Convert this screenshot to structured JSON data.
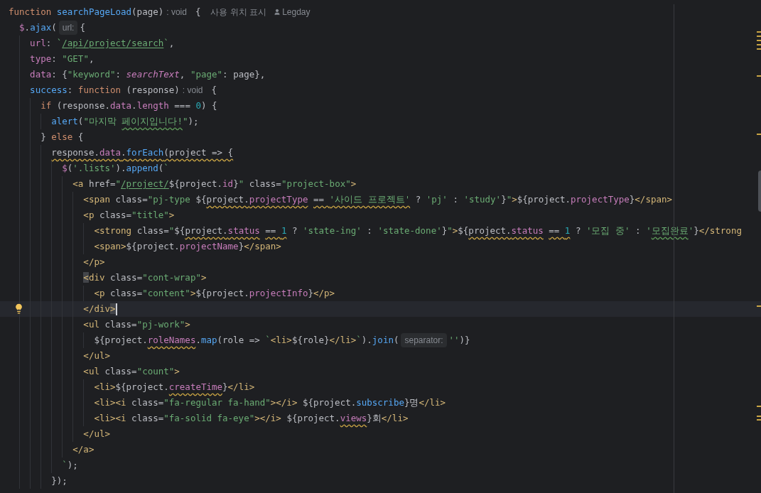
{
  "editor": {
    "lines": [
      {
        "current": false,
        "bulb": false,
        "tokens": [
          {
            "kind": "keyword",
            "text": "function "
          },
          {
            "kind": "fn",
            "text": "searchPageLoad"
          },
          {
            "kind": "plain",
            "text": "(page)"
          },
          {
            "kind": "typehint",
            "text": ": void"
          },
          {
            "kind": "plain",
            "text": "{"
          },
          {
            "kind": "meta",
            "text": "사용 위치 표시"
          },
          {
            "kind": "author",
            "text": "Legday"
          }
        ]
      },
      {
        "current": false,
        "bulb": false,
        "tokens": [
          {
            "kind": "prop",
            "text": "  $"
          },
          {
            "kind": "plain",
            "text": "."
          },
          {
            "kind": "fn",
            "text": "ajax"
          },
          {
            "kind": "plain",
            "text": "("
          },
          {
            "kind": "hint",
            "text": "url:"
          },
          {
            "kind": "plain",
            "text": "{"
          }
        ]
      },
      {
        "current": false,
        "bulb": false,
        "tokens": [
          {
            "kind": "prop",
            "text": "    url"
          },
          {
            "kind": "plain",
            "text": ": "
          },
          {
            "kind": "str",
            "text": "`"
          },
          {
            "kind": "link",
            "text": "/api/project/search"
          },
          {
            "kind": "str",
            "text": "`"
          },
          {
            "kind": "plain",
            "text": ","
          }
        ]
      },
      {
        "current": false,
        "bulb": false,
        "tokens": [
          {
            "kind": "prop",
            "text": "    type"
          },
          {
            "kind": "plain",
            "text": ": "
          },
          {
            "kind": "str",
            "text": "\"GET\""
          },
          {
            "kind": "plain",
            "text": ","
          }
        ]
      },
      {
        "current": false,
        "bulb": false,
        "tokens": [
          {
            "kind": "prop",
            "text": "    data"
          },
          {
            "kind": "plain",
            "text": ": {"
          },
          {
            "kind": "str",
            "text": "\"keyword\""
          },
          {
            "kind": "plain",
            "text": ": "
          },
          {
            "kind": "global",
            "text": "searchText"
          },
          {
            "kind": "plain",
            "text": ", "
          },
          {
            "kind": "str",
            "text": "\"page\""
          },
          {
            "kind": "plain",
            "text": ": page},"
          }
        ]
      },
      {
        "current": false,
        "bulb": false,
        "tokens": [
          {
            "kind": "fn",
            "text": "    success"
          },
          {
            "kind": "plain",
            "text": ": "
          },
          {
            "kind": "keyword",
            "text": "function "
          },
          {
            "kind": "plain",
            "text": "(response)"
          },
          {
            "kind": "typehint",
            "text": ": void"
          },
          {
            "kind": "plain",
            "text": "{"
          }
        ]
      },
      {
        "current": false,
        "bulb": false,
        "tokens": [
          {
            "kind": "keyword",
            "text": "      if "
          },
          {
            "kind": "plain",
            "text": "(response."
          },
          {
            "kind": "prop",
            "text": "data"
          },
          {
            "kind": "plain",
            "text": "."
          },
          {
            "kind": "prop",
            "text": "length"
          },
          {
            "kind": "plain",
            "text": " === "
          },
          {
            "kind": "num",
            "text": "0"
          },
          {
            "kind": "plain",
            "text": ") {"
          }
        ]
      },
      {
        "current": false,
        "bulb": false,
        "tokens": [
          {
            "kind": "fn",
            "text": "        alert"
          },
          {
            "kind": "plain",
            "text": "("
          },
          {
            "kind": "str",
            "text": "\"마지막 "
          },
          {
            "kind": "str",
            "text": "페이지입니다!",
            "typo": true
          },
          {
            "kind": "str",
            "text": "\""
          },
          {
            "kind": "plain",
            "text": ");"
          }
        ]
      },
      {
        "current": false,
        "bulb": false,
        "tokens": [
          {
            "kind": "plain",
            "text": "      } "
          },
          {
            "kind": "keyword",
            "text": "else "
          },
          {
            "kind": "plain",
            "text": "{"
          }
        ]
      },
      {
        "current": false,
        "bulb": false,
        "tokens": [
          {
            "kind": "plain",
            "text": "        response.",
            "warning": true
          },
          {
            "kind": "prop",
            "text": "data",
            "warning": true
          },
          {
            "kind": "plain",
            "text": ".",
            "warning": true
          },
          {
            "kind": "fn",
            "text": "forEach",
            "warning": true
          },
          {
            "kind": "plain",
            "text": "(project => {",
            "warning": true
          }
        ]
      },
      {
        "current": false,
        "bulb": false,
        "tokens": [
          {
            "kind": "prop",
            "text": "          $"
          },
          {
            "kind": "plain",
            "text": "("
          },
          {
            "kind": "str",
            "text": "'.lists'"
          },
          {
            "kind": "plain",
            "text": ")."
          },
          {
            "kind": "fn",
            "text": "append"
          },
          {
            "kind": "plain",
            "text": "("
          },
          {
            "kind": "str",
            "text": "`"
          }
        ]
      },
      {
        "current": false,
        "bulb": false,
        "tokens": [
          {
            "kind": "tag",
            "text": "            <a "
          },
          {
            "kind": "plain",
            "text": "href="
          },
          {
            "kind": "str",
            "text": "\""
          },
          {
            "kind": "link",
            "text": "/project/"
          },
          {
            "kind": "plain",
            "text": "${project."
          },
          {
            "kind": "prop",
            "text": "id"
          },
          {
            "kind": "plain",
            "text": "}"
          },
          {
            "kind": "str",
            "text": "\""
          },
          {
            "kind": "plain",
            "text": " class="
          },
          {
            "kind": "str",
            "text": "\"project-box\""
          },
          {
            "kind": "tag",
            "text": ">"
          }
        ]
      },
      {
        "current": false,
        "bulb": false,
        "tokens": [
          {
            "kind": "tag",
            "text": "              <span "
          },
          {
            "kind": "plain",
            "text": "class="
          },
          {
            "kind": "str",
            "text": "\"pj-type "
          },
          {
            "kind": "plain",
            "text": "${"
          },
          {
            "kind": "plain",
            "text": "project.",
            "warning": true
          },
          {
            "kind": "prop",
            "text": "projectType",
            "warning": true
          },
          {
            "kind": "plain",
            "text": " == ",
            "warning": true
          },
          {
            "kind": "str",
            "text": "'사이드 프로젝트'",
            "warning": true
          },
          {
            "kind": "plain",
            "text": " ? "
          },
          {
            "kind": "str",
            "text": "'pj'"
          },
          {
            "kind": "plain",
            "text": " : "
          },
          {
            "kind": "str",
            "text": "'study'"
          },
          {
            "kind": "plain",
            "text": "}"
          },
          {
            "kind": "str",
            "text": "\""
          },
          {
            "kind": "tag",
            "text": ">"
          },
          {
            "kind": "plain",
            "text": "${project."
          },
          {
            "kind": "prop",
            "text": "projectType"
          },
          {
            "kind": "plain",
            "text": "}"
          },
          {
            "kind": "tag",
            "text": "</span>"
          }
        ]
      },
      {
        "current": false,
        "bulb": false,
        "tokens": [
          {
            "kind": "tag",
            "text": "              <p "
          },
          {
            "kind": "plain",
            "text": "class="
          },
          {
            "kind": "str",
            "text": "\"title\""
          },
          {
            "kind": "tag",
            "text": ">"
          }
        ]
      },
      {
        "current": false,
        "bulb": false,
        "tokens": [
          {
            "kind": "tag",
            "text": "                <strong "
          },
          {
            "kind": "plain",
            "text": "class="
          },
          {
            "kind": "str",
            "text": "\""
          },
          {
            "kind": "plain",
            "text": "${"
          },
          {
            "kind": "plain",
            "text": "project.",
            "warning": true
          },
          {
            "kind": "prop",
            "text": "status",
            "warning": true
          },
          {
            "kind": "plain",
            "text": " == ",
            "warning": true
          },
          {
            "kind": "num",
            "text": "1",
            "warning": true
          },
          {
            "kind": "plain",
            "text": " ? "
          },
          {
            "kind": "str",
            "text": "'state-ing'"
          },
          {
            "kind": "plain",
            "text": " : "
          },
          {
            "kind": "str",
            "text": "'state-done'"
          },
          {
            "kind": "plain",
            "text": "}"
          },
          {
            "kind": "str",
            "text": "\""
          },
          {
            "kind": "tag",
            "text": ">"
          },
          {
            "kind": "plain",
            "text": "${"
          },
          {
            "kind": "plain",
            "text": "project.",
            "warning": true
          },
          {
            "kind": "prop",
            "text": "status",
            "warning": true
          },
          {
            "kind": "plain",
            "text": " == ",
            "warning": true
          },
          {
            "kind": "num",
            "text": "1",
            "warning": true
          },
          {
            "kind": "plain",
            "text": " ? "
          },
          {
            "kind": "str",
            "text": "'모집 중'"
          },
          {
            "kind": "plain",
            "text": " : "
          },
          {
            "kind": "str",
            "text": "'"
          },
          {
            "kind": "str",
            "text": "모집완료",
            "typo": true
          },
          {
            "kind": "str",
            "text": "'"
          },
          {
            "kind": "plain",
            "text": "}"
          },
          {
            "kind": "tag",
            "text": "</strong"
          }
        ]
      },
      {
        "current": false,
        "bulb": false,
        "tokens": [
          {
            "kind": "tag",
            "text": "                <span>"
          },
          {
            "kind": "plain",
            "text": "${project."
          },
          {
            "kind": "prop",
            "text": "projectName"
          },
          {
            "kind": "plain",
            "text": "}"
          },
          {
            "kind": "tag",
            "text": "</span>"
          }
        ]
      },
      {
        "current": false,
        "bulb": false,
        "tokens": [
          {
            "kind": "tag",
            "text": "              </p>"
          }
        ]
      },
      {
        "current": false,
        "bulb": false,
        "tokens": [
          {
            "kind": "tag",
            "text": "              <",
            "match": true
          },
          {
            "kind": "tag",
            "text": "div "
          },
          {
            "kind": "plain",
            "text": "class="
          },
          {
            "kind": "str",
            "text": "\"cont-wrap\""
          },
          {
            "kind": "tag",
            "text": ">"
          }
        ]
      },
      {
        "current": false,
        "bulb": false,
        "tokens": [
          {
            "kind": "tag",
            "text": "                <p "
          },
          {
            "kind": "plain",
            "text": "class="
          },
          {
            "kind": "str",
            "text": "\"content\""
          },
          {
            "kind": "tag",
            "text": ">"
          },
          {
            "kind": "plain",
            "text": "${project."
          },
          {
            "kind": "prop",
            "text": "projectInfo"
          },
          {
            "kind": "plain",
            "text": "}"
          },
          {
            "kind": "tag",
            "text": "</p>"
          }
        ]
      },
      {
        "current": true,
        "bulb": true,
        "tokens": [
          {
            "kind": "tag",
            "text": "              </div"
          },
          {
            "kind": "tag",
            "text": ">",
            "match": true
          }
        ]
      },
      {
        "current": false,
        "bulb": false,
        "tokens": [
          {
            "kind": "tag",
            "text": "              <ul "
          },
          {
            "kind": "plain",
            "text": "class="
          },
          {
            "kind": "str",
            "text": "\"pj-work\""
          },
          {
            "kind": "tag",
            "text": ">"
          }
        ]
      },
      {
        "current": false,
        "bulb": false,
        "tokens": [
          {
            "kind": "plain",
            "text": "                ${project."
          },
          {
            "kind": "prop",
            "text": "roleNames",
            "warning": true
          },
          {
            "kind": "plain",
            "text": "."
          },
          {
            "kind": "fn",
            "text": "map"
          },
          {
            "kind": "plain",
            "text": "(role => "
          },
          {
            "kind": "str",
            "text": "`"
          },
          {
            "kind": "tag",
            "text": "<li>"
          },
          {
            "kind": "plain",
            "text": "${role}"
          },
          {
            "kind": "tag",
            "text": "</li>"
          },
          {
            "kind": "str",
            "text": "`"
          },
          {
            "kind": "plain",
            "text": ")."
          },
          {
            "kind": "fn",
            "text": "join"
          },
          {
            "kind": "plain",
            "text": "("
          },
          {
            "kind": "hint",
            "text": "separator:"
          },
          {
            "kind": "str",
            "text": "''"
          },
          {
            "kind": "plain",
            "text": ")}"
          }
        ]
      },
      {
        "current": false,
        "bulb": false,
        "tokens": [
          {
            "kind": "tag",
            "text": "              </ul>"
          }
        ]
      },
      {
        "current": false,
        "bulb": false,
        "tokens": [
          {
            "kind": "tag",
            "text": "              <ul "
          },
          {
            "kind": "plain",
            "text": "class="
          },
          {
            "kind": "str",
            "text": "\"count\""
          },
          {
            "kind": "tag",
            "text": ">"
          }
        ]
      },
      {
        "current": false,
        "bulb": false,
        "tokens": [
          {
            "kind": "tag",
            "text": "                <li>"
          },
          {
            "kind": "plain",
            "text": "${project."
          },
          {
            "kind": "prop",
            "text": "createTime",
            "warning": true
          },
          {
            "kind": "plain",
            "text": "}"
          },
          {
            "kind": "tag",
            "text": "</li>"
          }
        ]
      },
      {
        "current": false,
        "bulb": false,
        "tokens": [
          {
            "kind": "tag",
            "text": "                <li><i "
          },
          {
            "kind": "plain",
            "text": "class="
          },
          {
            "kind": "str",
            "text": "\"fa-regular fa-hand\""
          },
          {
            "kind": "tag",
            "text": "></i>"
          },
          {
            "kind": "plain",
            "text": " ${project."
          },
          {
            "kind": "fn",
            "text": "subscribe"
          },
          {
            "kind": "plain",
            "text": "}명"
          },
          {
            "kind": "tag",
            "text": "</li>"
          }
        ]
      },
      {
        "current": false,
        "bulb": false,
        "tokens": [
          {
            "kind": "tag",
            "text": "                <li><i "
          },
          {
            "kind": "plain",
            "text": "class="
          },
          {
            "kind": "str",
            "text": "\"fa-solid fa-eye\""
          },
          {
            "kind": "tag",
            "text": "></i>"
          },
          {
            "kind": "plain",
            "text": " ${project."
          },
          {
            "kind": "prop",
            "text": "views",
            "warning": true
          },
          {
            "kind": "plain",
            "text": "}회"
          },
          {
            "kind": "tag",
            "text": "</li>"
          }
        ]
      },
      {
        "current": false,
        "bulb": false,
        "tokens": [
          {
            "kind": "tag",
            "text": "              </ul>"
          }
        ]
      },
      {
        "current": false,
        "bulb": false,
        "tokens": [
          {
            "kind": "tag",
            "text": "            </a>"
          }
        ]
      },
      {
        "current": false,
        "bulb": false,
        "tokens": [
          {
            "kind": "str",
            "text": "          `"
          },
          {
            "kind": "plain",
            "text": ");"
          }
        ]
      },
      {
        "current": false,
        "bulb": false,
        "tokens": [
          {
            "kind": "plain",
            "text": "        });"
          }
        ]
      }
    ]
  }
}
